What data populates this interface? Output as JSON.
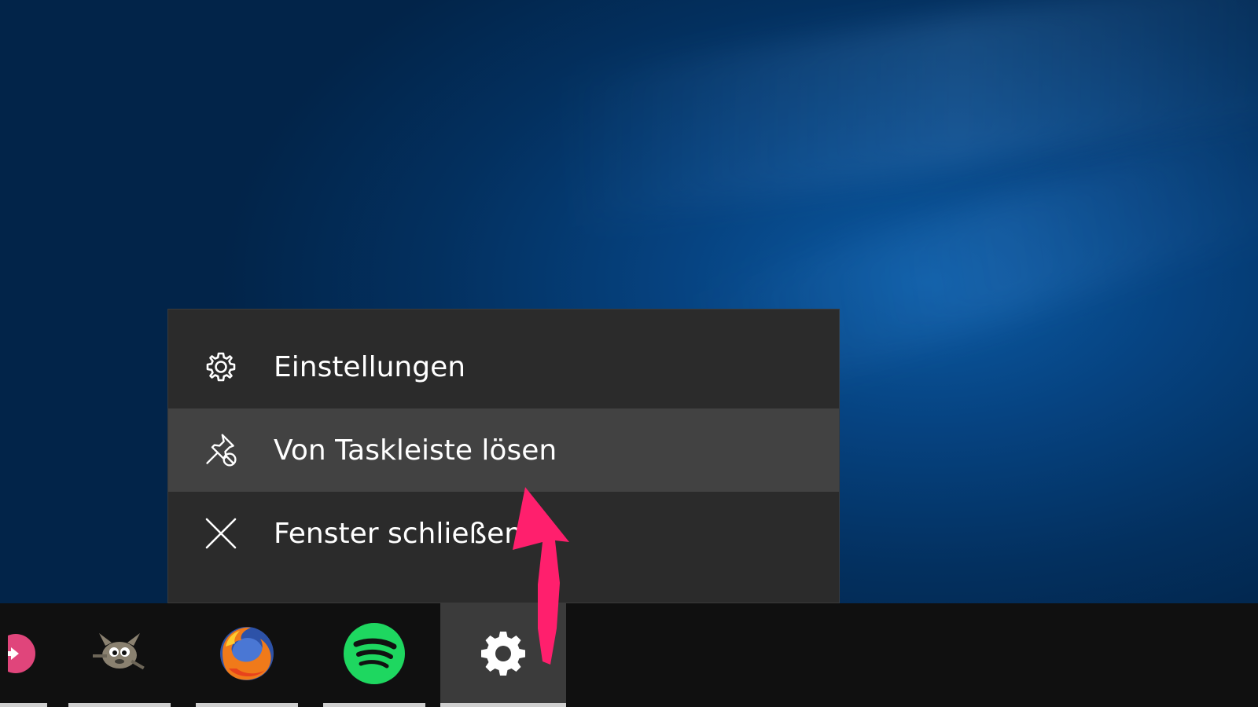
{
  "context_menu": {
    "items": [
      {
        "label": "Einstellungen",
        "icon": "gear-icon"
      },
      {
        "label": "Von Taskleiste lösen",
        "icon": "unpin-icon",
        "hovered": true
      },
      {
        "label": "Fenster schließen",
        "icon": "close-icon"
      }
    ]
  },
  "taskbar": {
    "apps": [
      {
        "icon": "pink-app-icon"
      },
      {
        "icon": "gimp-icon"
      },
      {
        "icon": "firefox-icon"
      },
      {
        "icon": "spotify-icon"
      },
      {
        "icon": "settings-gear-icon",
        "active": true
      }
    ]
  },
  "colors": {
    "menu_background": "#2b2b2b",
    "menu_hover": "#424242",
    "taskbar": "#101010",
    "annotation_arrow": "#ff1f6d",
    "spotify": "#1ed760"
  }
}
